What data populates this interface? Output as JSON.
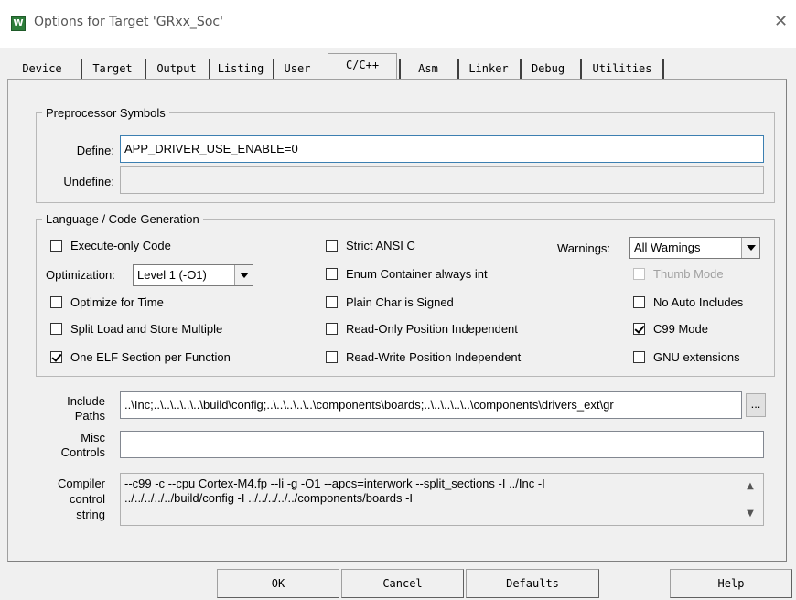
{
  "window": {
    "title": "Options for Target 'GRxx_Soc'",
    "app_icon_glyph": "W",
    "close_glyph": "✕"
  },
  "tabs": [
    {
      "label": "Device",
      "active": false
    },
    {
      "label": "Target",
      "active": false
    },
    {
      "label": "Output",
      "active": false
    },
    {
      "label": "Listing",
      "active": false
    },
    {
      "label": "User",
      "active": false
    },
    {
      "label": "C/C++",
      "active": true
    },
    {
      "label": "Asm",
      "active": false
    },
    {
      "label": "Linker",
      "active": false
    },
    {
      "label": "Debug",
      "active": false
    },
    {
      "label": "Utilities",
      "active": false
    }
  ],
  "preprocessor": {
    "legend": "Preprocessor Symbols",
    "define_label": "Define:",
    "define_value": "APP_DRIVER_USE_ENABLE=0",
    "undefine_label": "Undefine:",
    "undefine_value": ""
  },
  "language": {
    "legend": "Language / Code Generation",
    "col1": [
      {
        "label": "Execute-only Code",
        "checked": false
      },
      {
        "label": "Optimize for Time",
        "checked": false
      },
      {
        "label": "Split Load and Store Multiple",
        "checked": false
      },
      {
        "label": "One ELF Section per Function",
        "checked": true
      }
    ],
    "optimization_label": "Optimization:",
    "optimization_value": "Level 1 (-O1)",
    "col2": [
      {
        "label": "Strict ANSI C",
        "checked": false
      },
      {
        "label": "Enum Container always int",
        "checked": false
      },
      {
        "label": "Plain Char is Signed",
        "checked": false
      },
      {
        "label": "Read-Only Position Independent",
        "checked": false
      },
      {
        "label": "Read-Write Position Independent",
        "checked": false
      }
    ],
    "warnings_label": "Warnings:",
    "warnings_value": "All Warnings",
    "col3": [
      {
        "label": "Thumb Mode",
        "checked": false,
        "disabled": true
      },
      {
        "label": "No Auto Includes",
        "checked": false,
        "disabled": false
      },
      {
        "label": "C99 Mode",
        "checked": true,
        "disabled": false
      },
      {
        "label": "GNU extensions",
        "checked": false,
        "disabled": false
      }
    ]
  },
  "include_paths": {
    "label_line1": "Include",
    "label_line2": "Paths",
    "value": "..\\Inc;..\\..\\..\\..\\..\\build\\config;..\\..\\..\\..\\..\\components\\boards;..\\..\\..\\..\\..\\components\\drivers_ext\\gr",
    "browse_label": "..."
  },
  "misc_controls": {
    "label_line1": "Misc",
    "label_line2": "Controls",
    "value": ""
  },
  "compiler_string": {
    "label_line1": "Compiler",
    "label_line2": "control",
    "label_line3": "string",
    "line1": "--c99 -c --cpu Cortex-M4.fp --li -g -O1 --apcs=interwork --split_sections -I ../Inc -I",
    "line2": "../../../../../build/config -I ../../../../../components/boards -I"
  },
  "buttons": {
    "ok": "OK",
    "cancel": "Cancel",
    "defaults": "Defaults",
    "help": "Help"
  },
  "icons": {
    "scroll_up": "▲",
    "scroll_down": "▼"
  }
}
